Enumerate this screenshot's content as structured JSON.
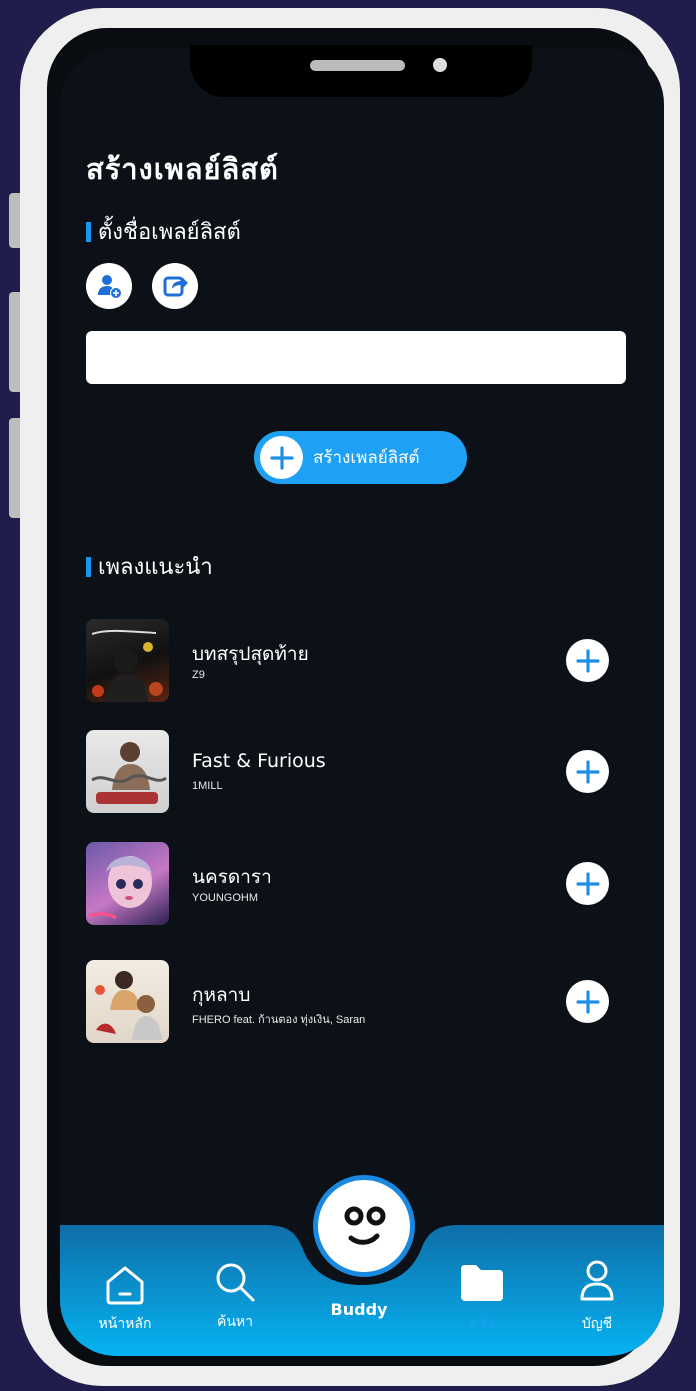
{
  "page": {
    "title": "สร้างเพลย์ลิสต์",
    "name_section": "ตั้งชื่อเพลย์ลิสต์",
    "playlist_name_value": "",
    "create_button_label": "สร้างเพลย์ลิสต์",
    "recommend_section": "เพลงแนะนำ"
  },
  "icons": {
    "add_user": "add-user-icon",
    "share": "share-icon",
    "plus": "plus-icon"
  },
  "songs": [
    {
      "title": "บทสรุปสุดท้าย",
      "artist": "Z9"
    },
    {
      "title": "Fast & Furious",
      "artist": "1MILL"
    },
    {
      "title": "นครดารา",
      "artist": "YOUNGOHM"
    },
    {
      "title": "กุหลาบ",
      "artist": "FHERO feat. ก้านตอง ทุ่งเงิน, Saran"
    }
  ],
  "nav": {
    "home": "หน้าหลัก",
    "search": "ค้นหา",
    "buddy": "Buddy",
    "library": "คลัง",
    "account": "บัญชี"
  },
  "colors": {
    "accent": "#1ea0f4",
    "background": "#0c1117",
    "frame": "#efefef",
    "page_bg": "#201c4c"
  }
}
